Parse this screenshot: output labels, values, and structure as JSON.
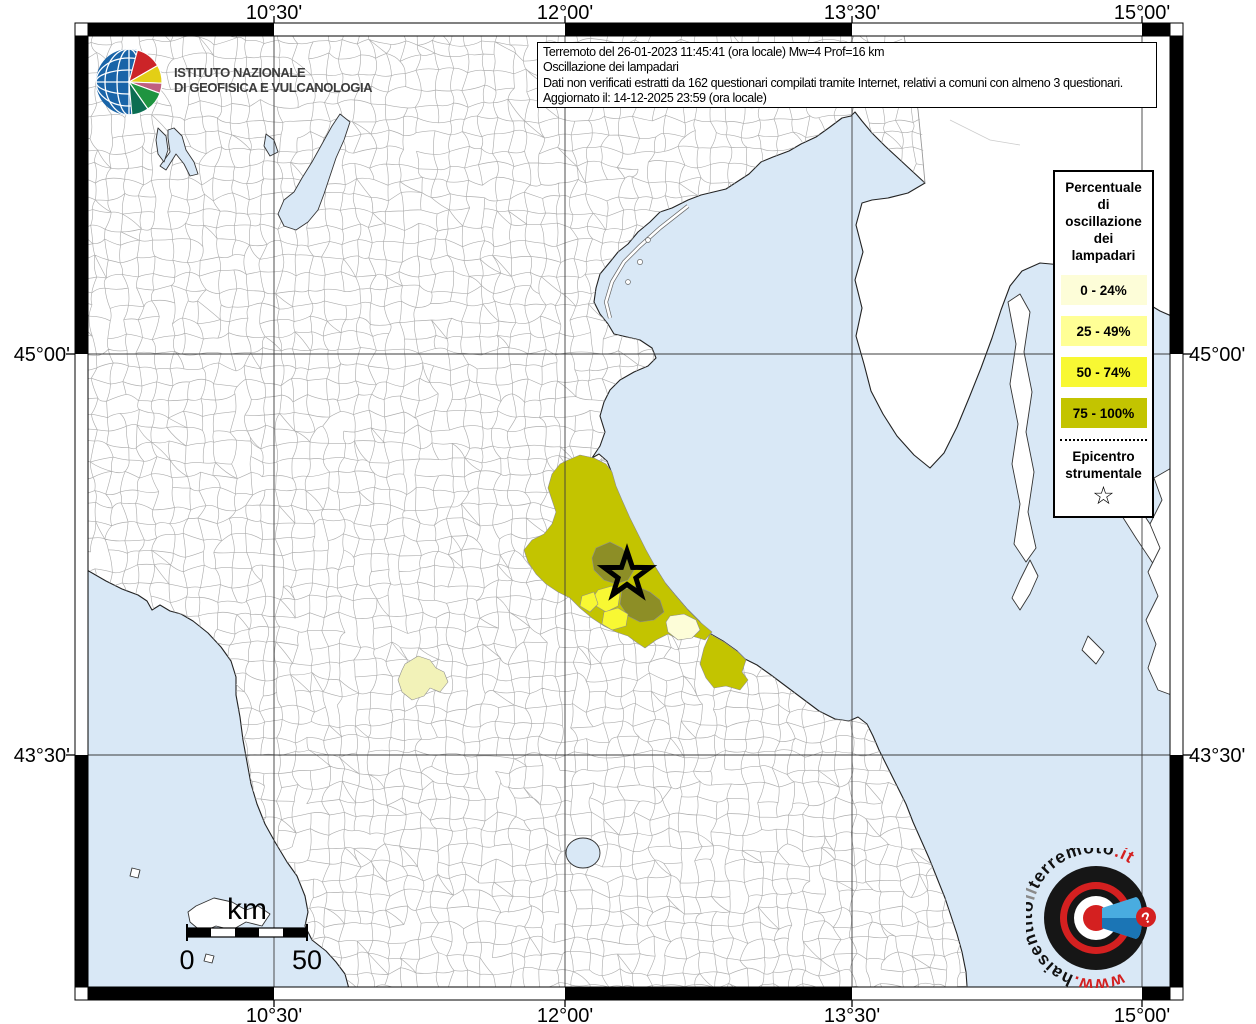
{
  "ingv": {
    "line1": "ISTITUTO NAZIONALE",
    "line2": "DI GEOFISICA E VULCANOLOGIA"
  },
  "title_box": {
    "lines": [
      "Terremoto del 26-01-2023 11:45:41 (ora locale) Mw=4 Prof=16 km",
      "Oscillazione dei lampadari",
      "Dati non verificati estratti da 162 questionari compilati tramite Internet, relativi a comuni con almeno 3 questionari.",
      "Aggiornato il: 14-12-2025 23:59 (ora locale)"
    ]
  },
  "legend": {
    "title_lines": [
      "Percentuale",
      "di",
      "oscillazione",
      "dei",
      "lampadari"
    ],
    "items": [
      {
        "label": "0 - 24%",
        "color": "#fdfdd8"
      },
      {
        "label": "25 - 49%",
        "color": "#ffff96"
      },
      {
        "label": "50 - 74%",
        "color": "#f8f833"
      },
      {
        "label": "75 - 100%",
        "color": "#c3c400"
      }
    ],
    "epicenter_lines": [
      "Epicentro",
      "strumentale"
    ],
    "star_glyph": "☆"
  },
  "axes": {
    "top": [
      "10°30'",
      "12°00'",
      "13°30'",
      "15°00'"
    ],
    "bottom": [
      "10°30'",
      "12°00'",
      "13°30'",
      "15°00'"
    ],
    "left": [
      "45°00'",
      "43°30'"
    ],
    "right": [
      "45°00'",
      "43°30'"
    ]
  },
  "scalebar": {
    "unit": "km",
    "start": "0",
    "end": "50"
  },
  "watermark": {
    "segments": [
      {
        "text": "www.",
        "color": "#d42020"
      },
      {
        "text": "haisentito",
        "color": "#111111"
      },
      {
        "text": "il",
        "color": "#8a8a8a"
      },
      {
        "text": "terremoto",
        "color": "#111111"
      },
      {
        "text": ".it",
        "color": "#d42020"
      }
    ],
    "question_mark": "?"
  },
  "map": {
    "sea_color": "#d9e8f6",
    "land_color": "#ffffff",
    "border_color": "#aeaeae",
    "class_colors": {
      "c0": "#fdfdd8",
      "c1": "#f2f2b8",
      "c2": "#f8f833",
      "c3": "#c3c400",
      "dark": "#8d8e26"
    }
  }
}
